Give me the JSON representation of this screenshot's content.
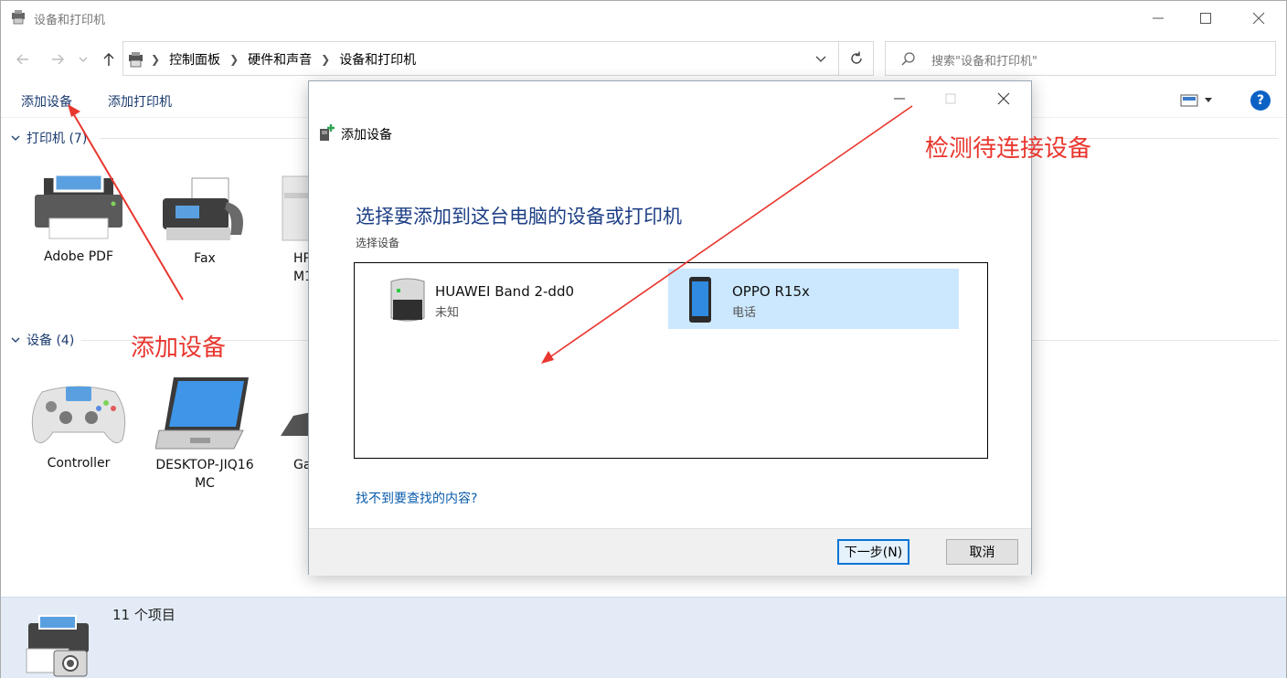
{
  "window": {
    "title": "设备和打印机",
    "minimize_icon": "minimize-icon",
    "maximize_icon": "maximize-icon",
    "close_icon": "close-icon"
  },
  "address": {
    "crumbs": [
      "控制面板",
      "硬件和声音",
      "设备和打印机"
    ],
    "search_placeholder": "搜索\"设备和打印机\""
  },
  "commands": {
    "add_device": "添加设备",
    "add_printer": "添加打印机",
    "help": "?"
  },
  "groups": {
    "printers": {
      "header": "打印机 (7)",
      "items": [
        {
          "label": "Adobe PDF",
          "icon": "printer-icon"
        },
        {
          "label": "Fax",
          "icon": "fax-icon"
        },
        {
          "label": "HP",
          "label2": "M1",
          "icon": "mfp-printer-icon"
        }
      ]
    },
    "devices": {
      "header": "设备 (4)",
      "items": [
        {
          "label": "Controller",
          "icon": "gamepad-icon"
        },
        {
          "label": "DESKTOP-JIQ16",
          "label2": "MC",
          "icon": "laptop-icon"
        },
        {
          "label": "Ga",
          "icon": "keyboard-icon"
        }
      ]
    }
  },
  "status": {
    "count": "11 个项目"
  },
  "dialog": {
    "title": "添加设备",
    "heading": "选择要添加到这台电脑的设备或打印机",
    "subheading": "选择设备",
    "devices": [
      {
        "name": "HUAWEI Band 2-dd0",
        "type": "未知",
        "icon": "generic-device-icon",
        "selected": false
      },
      {
        "name": "OPPO R15x",
        "type": "电话",
        "icon": "phone-icon",
        "selected": true
      }
    ],
    "help_link": "找不到要查找的内容?",
    "next_button": "下一步(N)",
    "cancel_button": "取消"
  },
  "annotations": {
    "add_device_note": "添加设备",
    "detect_note": "检测待连接设备",
    "color": "#e8372f"
  }
}
